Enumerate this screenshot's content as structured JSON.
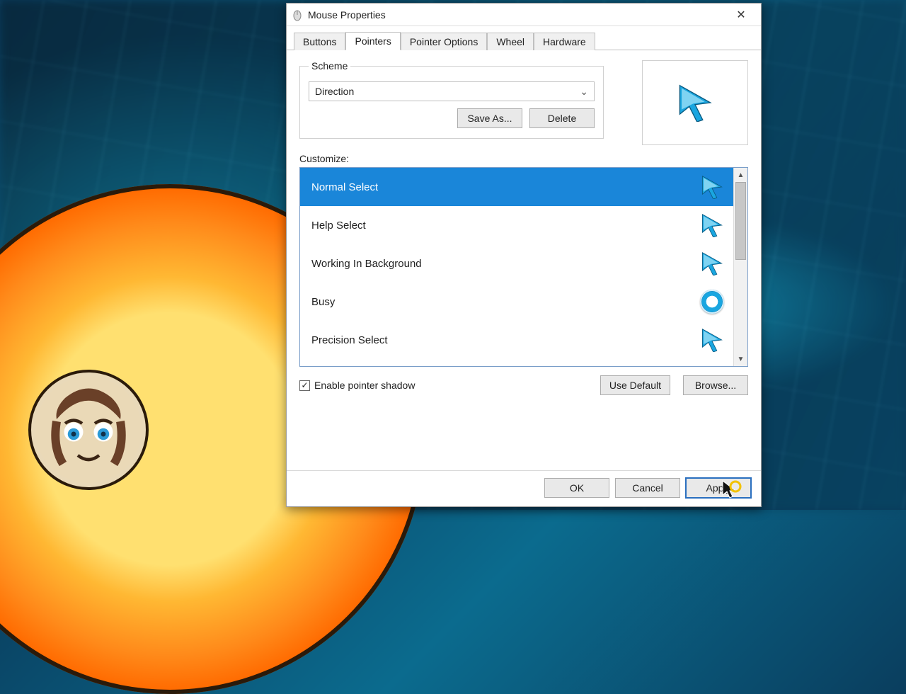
{
  "window": {
    "title": "Mouse Properties"
  },
  "tabs": [
    "Buttons",
    "Pointers",
    "Pointer Options",
    "Wheel",
    "Hardware"
  ],
  "active_tab_index": 1,
  "scheme": {
    "legend": "Scheme",
    "selected": "Direction",
    "save_as": "Save As...",
    "delete": "Delete"
  },
  "customize_label": "Customize:",
  "cursors": [
    {
      "label": "Normal Select",
      "icon": "arrow",
      "selected": true
    },
    {
      "label": "Help Select",
      "icon": "arrow",
      "selected": false
    },
    {
      "label": "Working In Background",
      "icon": "arrow",
      "selected": false
    },
    {
      "label": "Busy",
      "icon": "busy",
      "selected": false
    },
    {
      "label": "Precision Select",
      "icon": "arrow",
      "selected": false
    }
  ],
  "shadow_checkbox": {
    "label": "Enable pointer shadow",
    "checked": true
  },
  "buttons": {
    "use_default": "Use Default",
    "browse": "Browse...",
    "ok": "OK",
    "cancel": "Cancel",
    "apply": "Apply"
  },
  "colors": {
    "selection": "#1a86d9",
    "cursor": "#1aa6e0"
  }
}
